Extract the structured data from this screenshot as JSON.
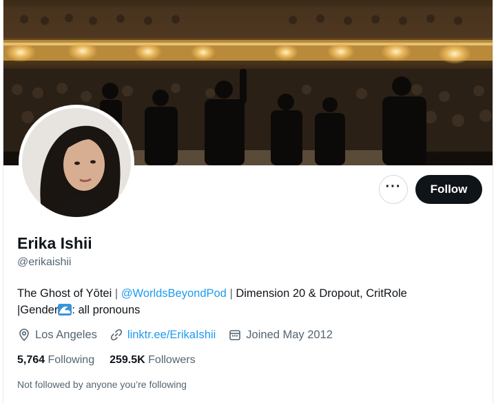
{
  "profile": {
    "name": "Erika Ishii",
    "handle": "@erikaishii",
    "follow_label": "Follow",
    "more_label": "···"
  },
  "bio": {
    "part1": "The Ghost of Yōtei",
    "sep1": " | ",
    "mention": "@WorldsBeyondPod",
    "sep2": " | ",
    "part2": "Dimension 20 & Dropout, CritRole",
    "part3": "|Gender",
    "part4": ": all pronouns",
    "emoji_icon": "wave-emoji-icon"
  },
  "meta": {
    "location": "Los Angeles",
    "url": "linktr.ee/ErikaIshii",
    "joined": "Joined May 2012",
    "icons": [
      "location-pin-icon",
      "link-icon",
      "calendar-icon"
    ]
  },
  "stats": {
    "following_count": "5,764",
    "following_label": "Following",
    "followers_count": "259.5K",
    "followers_label": "Followers"
  },
  "not_followed_text": "Not followed by anyone you’re following",
  "colors": {
    "accent": "#1d9bf0",
    "text": "#0f1419",
    "secondary": "#536471",
    "border": "#cfd9de",
    "button_dark": "#0f1419"
  }
}
